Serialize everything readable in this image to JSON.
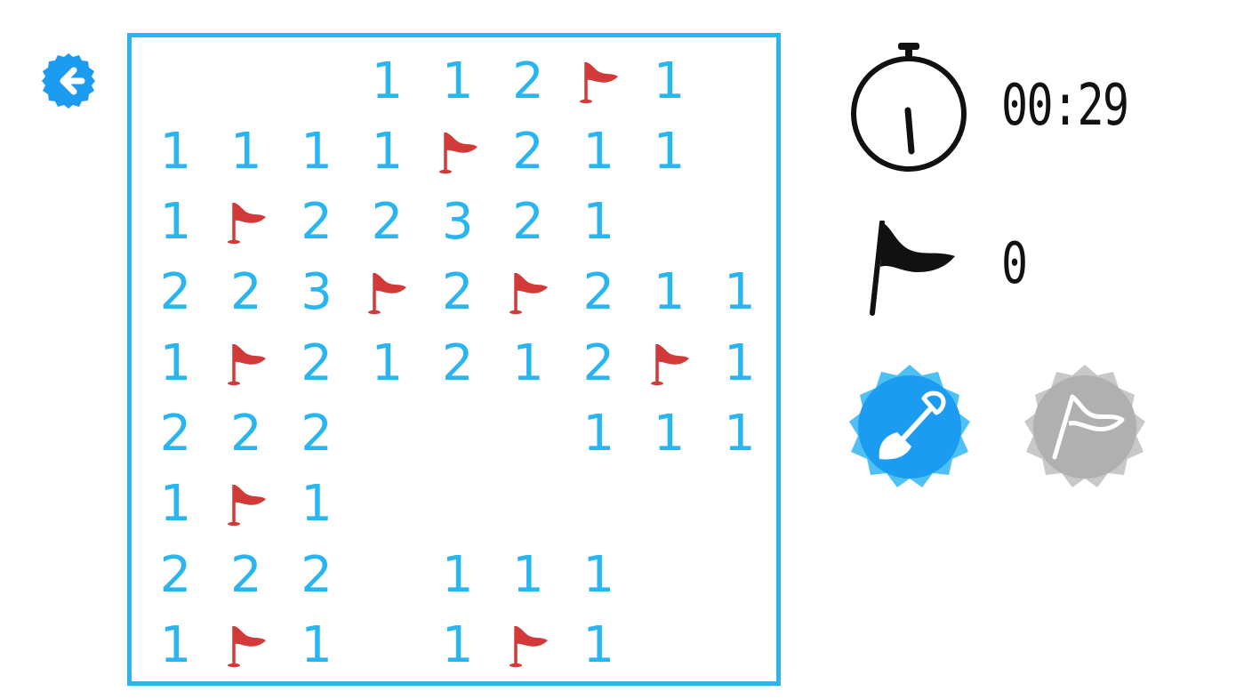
{
  "header": {
    "back_icon": "arrow-left-icon"
  },
  "board": {
    "rows": [
      [
        "",
        "",
        "",
        "1",
        "1",
        "2",
        "F",
        "1",
        ""
      ],
      [
        "1",
        "1",
        "1",
        "1",
        "F",
        "2",
        "1",
        "1",
        ""
      ],
      [
        "1",
        "F",
        "2",
        "2",
        "3",
        "2",
        "1",
        "",
        ""
      ],
      [
        "2",
        "2",
        "3",
        "F",
        "2",
        "F",
        "2",
        "1",
        "1"
      ],
      [
        "1",
        "F",
        "2",
        "1",
        "2",
        "1",
        "2",
        "F",
        "1"
      ],
      [
        "2",
        "2",
        "2",
        "",
        "",
        "",
        "1",
        "1",
        "1"
      ],
      [
        "1",
        "F",
        "1",
        "",
        "",
        "",
        "",
        "",
        ""
      ],
      [
        "2",
        "2",
        "2",
        "",
        "1",
        "1",
        "1",
        "",
        ""
      ],
      [
        "1",
        "F",
        "1",
        "",
        "1",
        "F",
        "1",
        "",
        ""
      ]
    ]
  },
  "status": {
    "timer": "00:29",
    "flag_count": "0",
    "timer_icon": "stopwatch-icon",
    "flag_icon": "flag-icon"
  },
  "modes": {
    "active": "dig",
    "dig_icon": "shovel-icon",
    "flag_icon": "flag-icon"
  },
  "colors": {
    "accent": "#29b6f0",
    "number": "#29b6f0",
    "flag": "#d23a3a",
    "active_mode": "#1b9cf0",
    "inactive_mode": "#b0b0b0",
    "text": "#111111"
  }
}
